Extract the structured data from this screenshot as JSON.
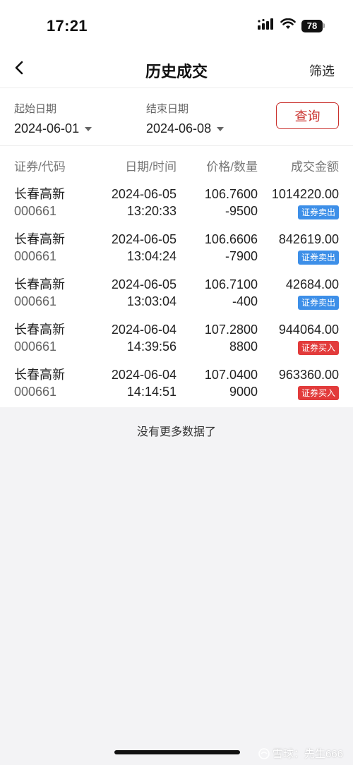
{
  "status_bar": {
    "time": "17:21",
    "battery": "78",
    "icons": [
      "signal-icon",
      "wifi-icon",
      "battery-icon"
    ]
  },
  "nav": {
    "title": "历史成交",
    "filter_label": "筛选",
    "back_icon": "chevron-left-icon"
  },
  "date_filter": {
    "start_label": "起始日期",
    "start_value": "2024-06-01",
    "end_label": "结束日期",
    "end_value": "2024-06-08",
    "query_label": "查询"
  },
  "table": {
    "headers": [
      "证券/代码",
      "日期/时间",
      "价格/数量",
      "成交金额"
    ],
    "rows": [
      {
        "name": "长春高新",
        "code": "000661",
        "date": "2024-06-05",
        "time": "13:20:33",
        "price": "106.7600",
        "qty": "-9500",
        "amount": "1014220.00",
        "badge": "证券卖出"
      },
      {
        "name": "长春高新",
        "code": "000661",
        "date": "2024-06-05",
        "time": "13:04:24",
        "price": "106.6606",
        "qty": "-7900",
        "amount": "842619.00",
        "badge": "证券卖出"
      },
      {
        "name": "长春高新",
        "code": "000661",
        "date": "2024-06-05",
        "time": "13:03:04",
        "price": "106.7100",
        "qty": "-400",
        "amount": "42684.00",
        "badge": "证券卖出"
      },
      {
        "name": "长春高新",
        "code": "000661",
        "date": "2024-06-04",
        "time": "14:39:56",
        "price": "107.2800",
        "qty": "8800",
        "amount": "944064.00",
        "badge": "证券买入"
      },
      {
        "name": "长春高新",
        "code": "000661",
        "date": "2024-06-04",
        "time": "14:14:51",
        "price": "107.0400",
        "qty": "9000",
        "amount": "963360.00",
        "badge": "证券买入"
      }
    ]
  },
  "footer": {
    "no_more": "没有更多数据了",
    "watermark": "雪球：先生666"
  },
  "colors": {
    "accent_red": "#c9302c",
    "sell_badge": "#3d8fe8",
    "buy_badge": "#e23b3b"
  }
}
